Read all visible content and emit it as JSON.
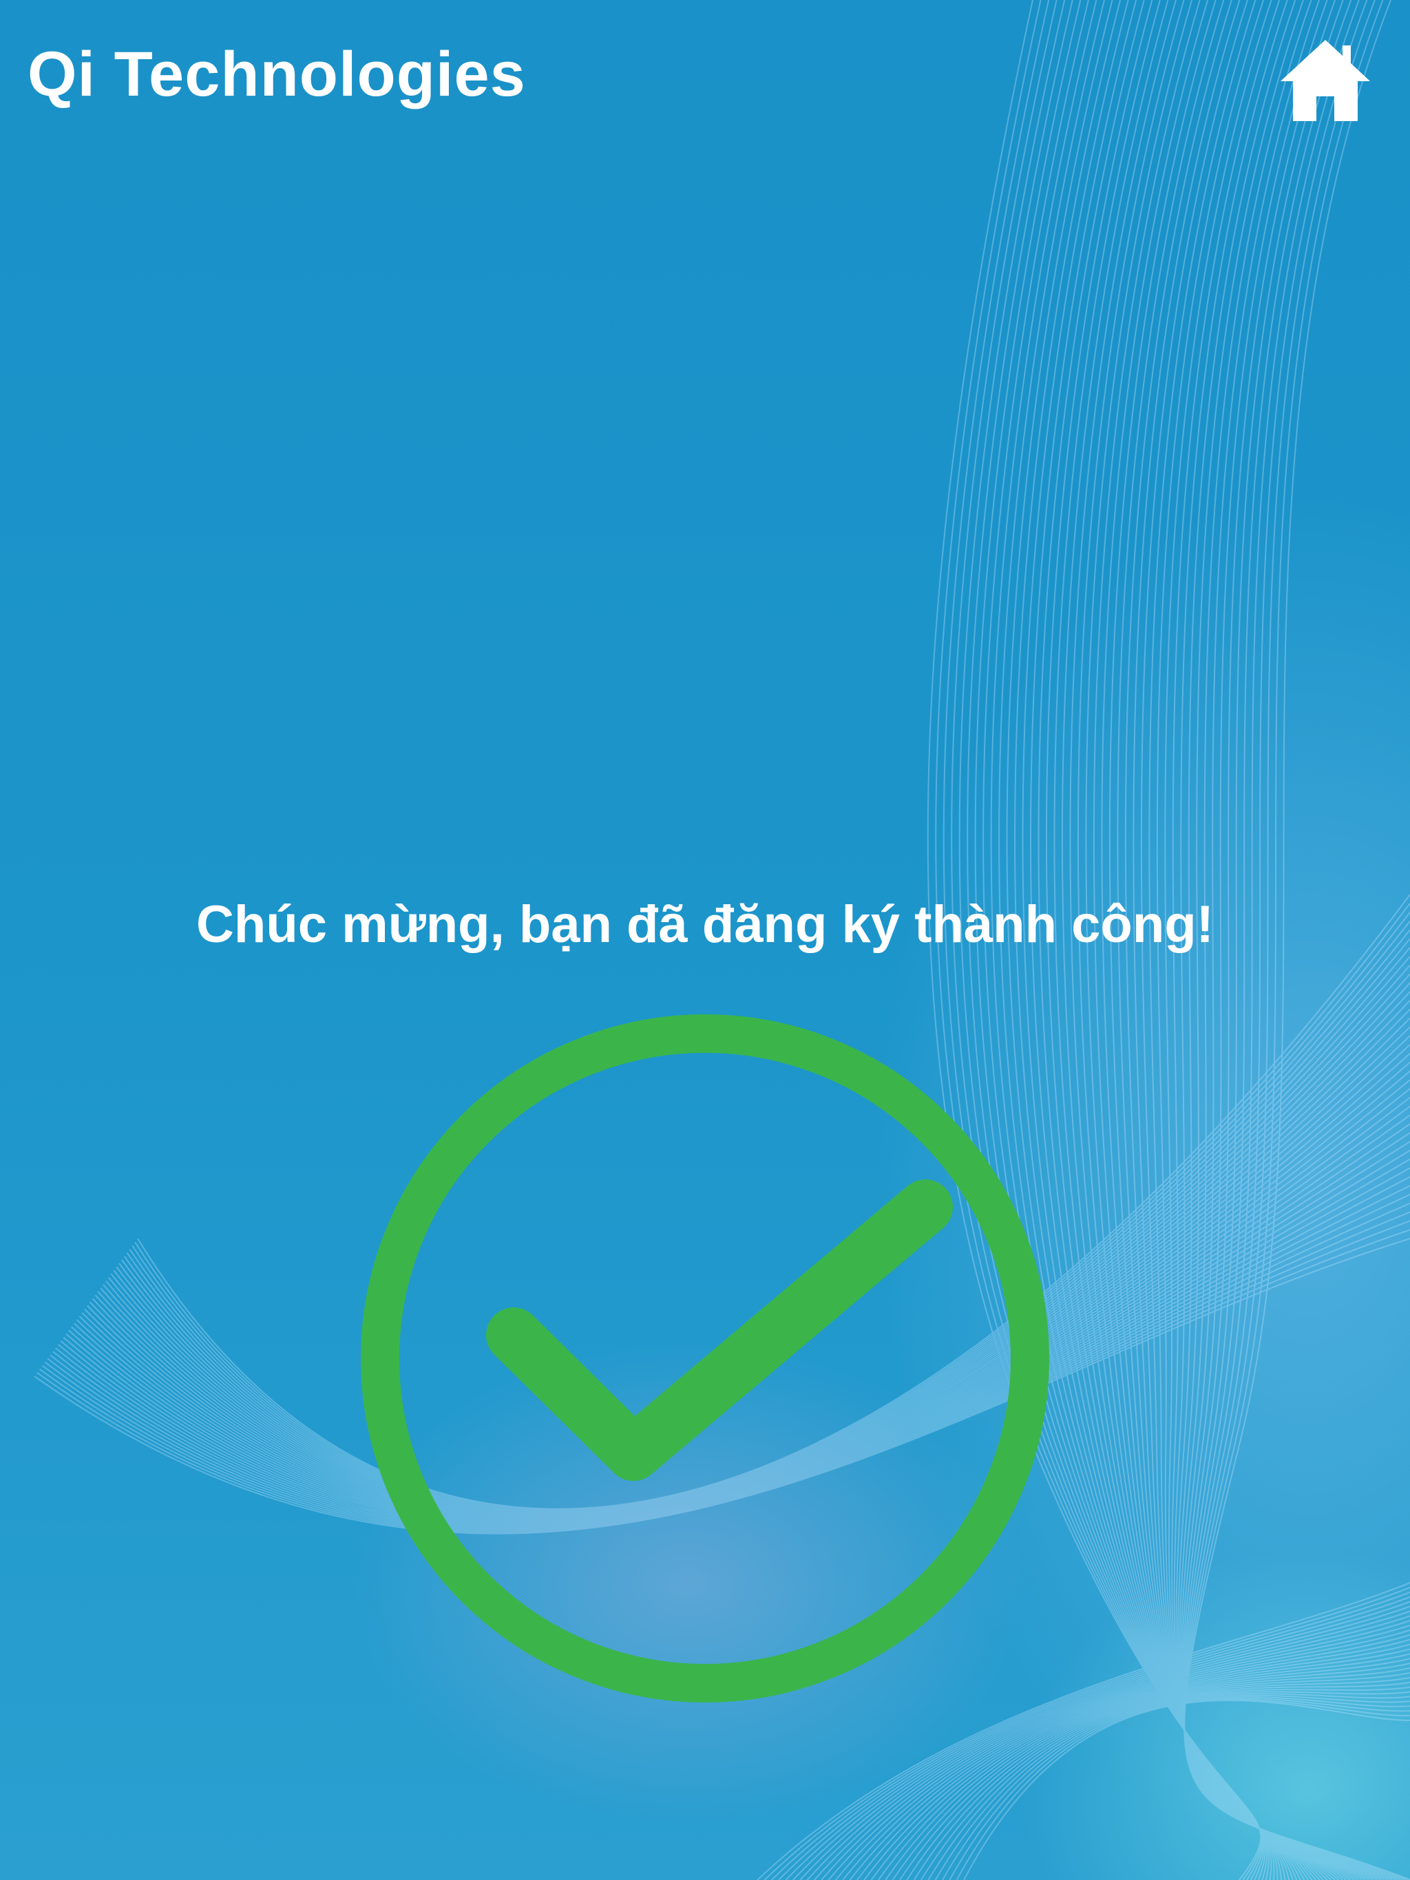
{
  "header": {
    "title": "Qi Technologies",
    "home_icon": "home-icon"
  },
  "main": {
    "message": "Chúc mừng, bạn đã đăng ký thành công!",
    "status_icon": "check-circle-icon"
  },
  "colors": {
    "background": "#1c93c9",
    "text": "#ffffff",
    "success": "#3bb54a"
  }
}
